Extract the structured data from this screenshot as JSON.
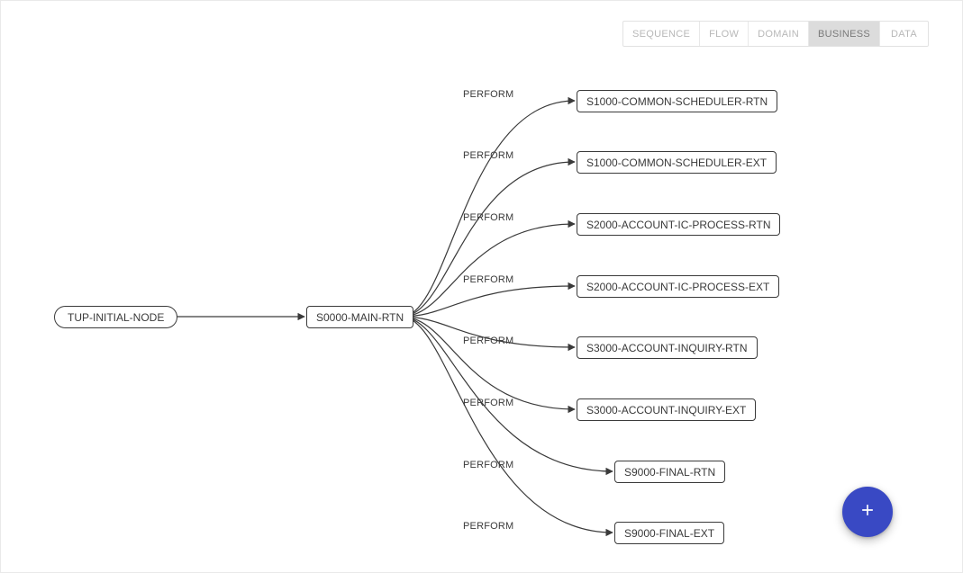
{
  "tabs": [
    {
      "id": "sequence",
      "label": "SEQUENCE",
      "active": false
    },
    {
      "id": "flow",
      "label": "FLOW",
      "active": false
    },
    {
      "id": "domain",
      "label": "DOMAIN",
      "active": false
    },
    {
      "id": "business",
      "label": "BUSINESS",
      "active": true
    },
    {
      "id": "data",
      "label": "DATA",
      "active": false
    }
  ],
  "nodes": {
    "root": {
      "label": "TUP-INITIAL-NODE"
    },
    "main": {
      "label": "S0000-MAIN-RTN"
    },
    "n1": {
      "label": "S1000-COMMON-SCHEDULER-RTN"
    },
    "n2": {
      "label": "S1000-COMMON-SCHEDULER-EXT"
    },
    "n3": {
      "label": "S2000-ACCOUNT-IC-PROCESS-RTN"
    },
    "n4": {
      "label": "S2000-ACCOUNT-IC-PROCESS-EXT"
    },
    "n5": {
      "label": "S3000-ACCOUNT-INQUIRY-RTN"
    },
    "n6": {
      "label": "S3000-ACCOUNT-INQUIRY-EXT"
    },
    "n7": {
      "label": "S9000-FINAL-RTN"
    },
    "n8": {
      "label": "S9000-FINAL-EXT"
    }
  },
  "edge_label": "PERFORM",
  "fab_icon": "plus"
}
